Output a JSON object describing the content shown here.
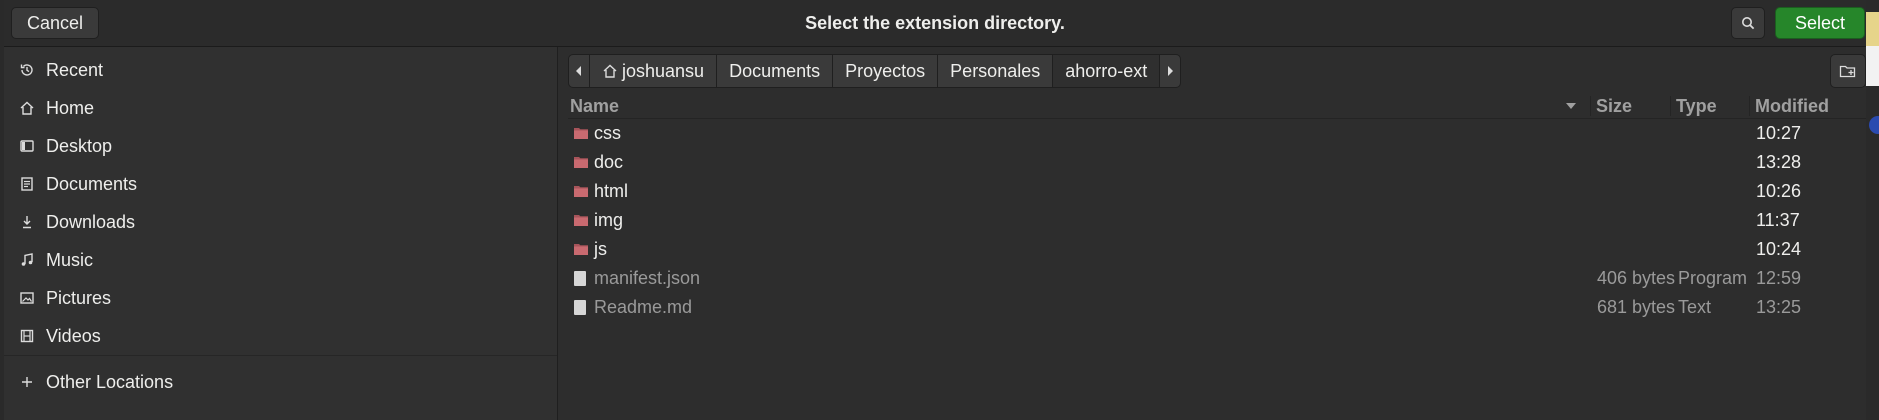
{
  "header": {
    "cancel_label": "Cancel",
    "title": "Select the extension directory.",
    "select_label": "Select"
  },
  "sidebar": {
    "items": [
      {
        "label": "Recent",
        "icon": "clock-icon"
      },
      {
        "label": "Home",
        "icon": "home-icon"
      },
      {
        "label": "Desktop",
        "icon": "desktop-icon"
      },
      {
        "label": "Documents",
        "icon": "document-icon"
      },
      {
        "label": "Downloads",
        "icon": "download-icon"
      },
      {
        "label": "Music",
        "icon": "music-note-icon"
      },
      {
        "label": "Pictures",
        "icon": "picture-icon"
      },
      {
        "label": "Videos",
        "icon": "film-icon"
      }
    ],
    "other_locations": {
      "label": "Other Locations",
      "icon": "plus-icon"
    }
  },
  "pathbar": {
    "segments": [
      "joshuansu",
      "Documents",
      "Proyectos",
      "Personales",
      "ahorro-ext"
    ]
  },
  "table": {
    "columns": {
      "name": "Name",
      "size": "Size",
      "type": "Type",
      "modified": "Modified"
    },
    "rows": [
      {
        "name": "css",
        "size": "",
        "type": "",
        "modified": "10:27",
        "kind": "folder"
      },
      {
        "name": "doc",
        "size": "",
        "type": "",
        "modified": "13:28",
        "kind": "folder"
      },
      {
        "name": "html",
        "size": "",
        "type": "",
        "modified": "10:26",
        "kind": "folder"
      },
      {
        "name": "img",
        "size": "",
        "type": "",
        "modified": "11:37",
        "kind": "folder"
      },
      {
        "name": "js",
        "size": "",
        "type": "",
        "modified": "10:24",
        "kind": "folder"
      },
      {
        "name": "manifest.json",
        "size": "406 bytes",
        "type": "Program",
        "modified": "12:59",
        "kind": "file"
      },
      {
        "name": "Readme.md",
        "size": "681 bytes",
        "type": "Text",
        "modified": "13:25",
        "kind": "file"
      }
    ]
  },
  "colors": {
    "accent_select": "#26862a",
    "folder": "#a7545a",
    "background": "#2d2d2d"
  }
}
